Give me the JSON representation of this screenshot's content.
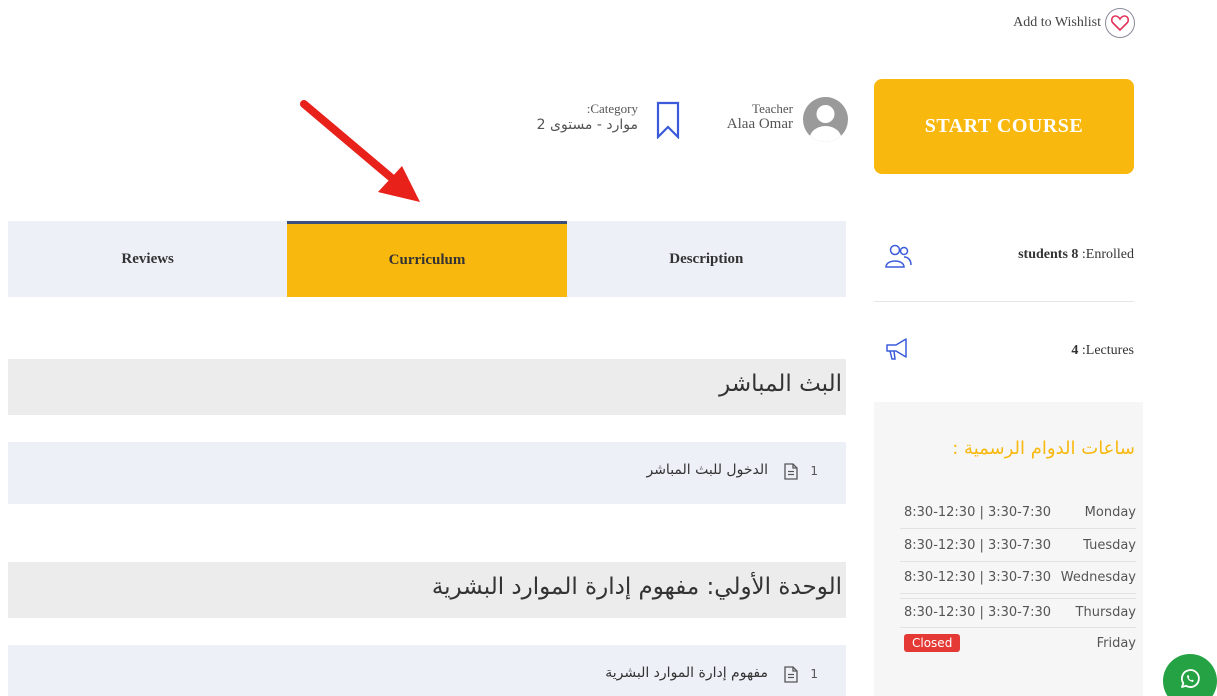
{
  "wishlist": {
    "label": "Add to Wishlist",
    "icon": "heart-icon"
  },
  "start_course": {
    "label": "START COURSE",
    "color": "#f8b80e"
  },
  "teacher": {
    "role": "Teacher",
    "name": "Alaa Omar"
  },
  "category": {
    "label": ":Category",
    "value": "موارد - مستوى 2"
  },
  "tabs": [
    {
      "label": "Reviews",
      "active": false
    },
    {
      "label": "Curriculum",
      "active": true
    },
    {
      "label": "Description",
      "active": false
    }
  ],
  "stats": {
    "enrolled": {
      "value": "students 8",
      "label": ":Enrolled",
      "icon": "users-icon"
    },
    "lectures": {
      "value": "4",
      "label": ":Lectures",
      "icon": "megaphone-icon"
    }
  },
  "office_hours": {
    "title": "ساعات الدوام الرسمية :",
    "rows": [
      {
        "day": "Monday",
        "time": "8:30-12:30 | 3:30-7:30"
      },
      {
        "day": "Tuesday",
        "time": "8:30-12:30 | 3:30-7:30"
      },
      {
        "day": "Wednesday",
        "time": "8:30-12:30 | 3:30-7:30"
      },
      {
        "day": "Thursday",
        "time": "8:30-12:30 | 3:30-7:30"
      },
      {
        "day": "Friday",
        "time": "Closed"
      }
    ]
  },
  "curriculum": {
    "sections": [
      {
        "title": "البث المباشر",
        "lessons": [
          {
            "num": "1",
            "title": "الدخول للبث المباشر"
          }
        ]
      },
      {
        "title": "الوحدة الأولي: مفهوم إدارة الموارد البشرية",
        "lessons": [
          {
            "num": "1",
            "title": "مفهوم إدارة الموارد البشرية"
          }
        ]
      }
    ]
  },
  "colors": {
    "accent": "#f8b80e",
    "tab_bg": "#eef0f8",
    "closed": "#e53935",
    "whatsapp": "#25a244",
    "arrow": "#e8211b"
  }
}
